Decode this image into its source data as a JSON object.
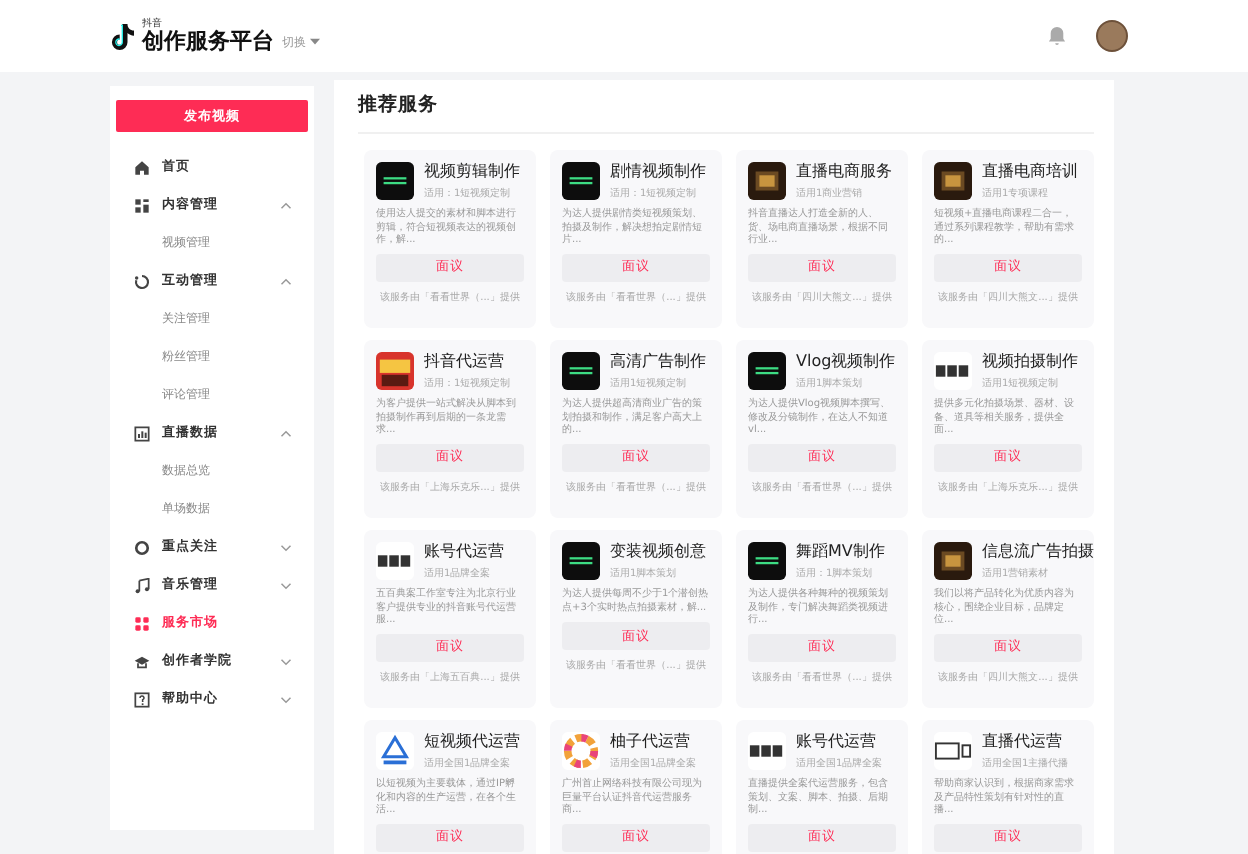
{
  "header": {
    "brand_small": "抖音",
    "brand": "创作服务平台",
    "switcher": "切换"
  },
  "sidebar": {
    "publish_button": "发布视频",
    "items": [
      {
        "label": "首页",
        "selected": false
      },
      {
        "label": "内容管理",
        "selected": false,
        "expanded": true,
        "children": [
          {
            "label": "视频管理",
            "selected": false
          }
        ]
      },
      {
        "label": "互动管理",
        "selected": false,
        "expanded": true,
        "children": [
          {
            "label": "关注管理",
            "selected": false
          },
          {
            "label": "粉丝管理",
            "selected": false
          },
          {
            "label": "评论管理",
            "selected": false
          }
        ]
      },
      {
        "label": "直播数据",
        "selected": false,
        "expanded": true,
        "children": [
          {
            "label": "数据总览",
            "selected": false
          },
          {
            "label": "单场数据",
            "selected": false
          }
        ]
      },
      {
        "label": "重点关注",
        "selected": false,
        "expanded": false
      },
      {
        "label": "音乐管理",
        "selected": false,
        "expanded": false
      },
      {
        "label": "服务市场",
        "selected": true
      },
      {
        "label": "创作者学院",
        "selected": false,
        "expanded": false
      },
      {
        "label": "帮助中心",
        "selected": false,
        "expanded": false
      }
    ]
  },
  "main": {
    "title": "推荐服务",
    "services": [
      {
        "kind": "dark",
        "title": "视频剪辑制作",
        "subtitle": "适用：1短视频定制",
        "description": "使用达人提交的素材和脚本进行剪辑，符合短视频表达的视频创作，解...",
        "price": "面议",
        "provider": "该服务由「看看世界（...」提供"
      },
      {
        "kind": "dark",
        "title": "剧情视频制作",
        "subtitle": "适用：1短视频定制",
        "description": "为达人提供剧情类短视频策划、拍摄及制作，解决想拍定剧情短片...",
        "price": "面议",
        "provider": "该服务由「看看世界（...」提供"
      },
      {
        "kind": "brown",
        "title": "直播电商服务",
        "subtitle": "适用1商业营销",
        "description": "抖音直播达人打造全新的人、货、场电商直播场景，根据不同行业...",
        "price": "面议",
        "provider": "该服务由「四川大熊文...」提供"
      },
      {
        "kind": "brown",
        "title": "直播电商培训",
        "subtitle": "适用1专项课程",
        "description": "短视频+直播电商课程二合一，通过系列课程教学，帮助有需求的...",
        "price": "面议",
        "provider": "该服务由「四川大熊文...」提供"
      },
      {
        "kind": "red",
        "title": "抖音代运营",
        "subtitle": "适用：1短视频定制",
        "description": "为客户提供一站式解决从脚本到拍摄制作再到后期的一条龙需求...",
        "price": "面议",
        "provider": "该服务由「上海乐克乐...」提供"
      },
      {
        "kind": "dark",
        "title": "高清广告制作",
        "subtitle": "适用1短视频定制",
        "description": "为达人提供超高清商业广告的策划拍摄和制作，满足客户高大上的...",
        "price": "面议",
        "provider": "该服务由「看看世界（...」提供"
      },
      {
        "kind": "dark",
        "title": "Vlog视频制作",
        "subtitle": "适用1脚本策划",
        "description": "为达人提供Vlog视频脚本撰写、修改及分镜制作，在达人不知道vl...",
        "price": "面议",
        "provider": "该服务由「看看世界（...」提供"
      },
      {
        "kind": "wordmark",
        "title": "视频拍摄制作",
        "subtitle": "适用1短视频定制",
        "description": "提供多元化拍摄场景、器材、设备、道具等相关服务，提供全面...",
        "price": "面议",
        "provider": "该服务由「上海乐克乐...」提供"
      },
      {
        "kind": "wordmark",
        "title": "账号代运营",
        "subtitle": "适用1品牌全案",
        "description": "五百典案工作室专注为北京行业客户提供专业的抖音账号代运营服...",
        "price": "面议",
        "provider": "该服务由「上海五百典...」提供"
      },
      {
        "kind": "dark",
        "title": "变装视频创意",
        "subtitle": "适用1脚本策划",
        "description": "为达人提供每周不少于1个潜创热点+3个实时热点拍摄素材，解...",
        "price": "面议",
        "provider": "该服务由「看看世界（...」提供"
      },
      {
        "kind": "dark",
        "title": "舞蹈MV制作",
        "subtitle": "适用：1脚本策划",
        "description": "为达人提供各种舞种的视频策划及制作，专门解决舞蹈类视频进行...",
        "price": "面议",
        "provider": "该服务由「看看世界（...」提供"
      },
      {
        "kind": "brown",
        "title": "信息流广告拍摄",
        "subtitle": "适用1营销素材",
        "description": "我们以将产品转化为优质内容为核心，围绕企业目标，品牌定位...",
        "price": "面议",
        "provider": "该服务由「四川大熊文...」提供"
      },
      {
        "kind": "triangle",
        "title": "短视频代运营",
        "subtitle": "适用全国1品牌全案",
        "description": "以短视频为主要载体，通过IP孵化和内容的生产运营，在各个生活...",
        "price": "面议"
      },
      {
        "kind": "ring",
        "title": "柚子代运营",
        "subtitle": "适用全国1品牌全案",
        "description": "广州首止网络科技有限公司现为巨量平台认证抖音代运营服务商...",
        "price": "面议"
      },
      {
        "kind": "wordmark",
        "title": "账号代运营",
        "subtitle": "适用全国1品牌全案",
        "description": "直播提供全案代运营服务，包含策划、文案、脚本、拍摄、后期制...",
        "price": "面议"
      },
      {
        "kind": "outline",
        "title": "直播代运营",
        "subtitle": "适用全国1主播代播",
        "description": "帮助商家认识到，根据商家需求及产品特性策划有针对性的直播...",
        "price": "面议"
      }
    ]
  }
}
